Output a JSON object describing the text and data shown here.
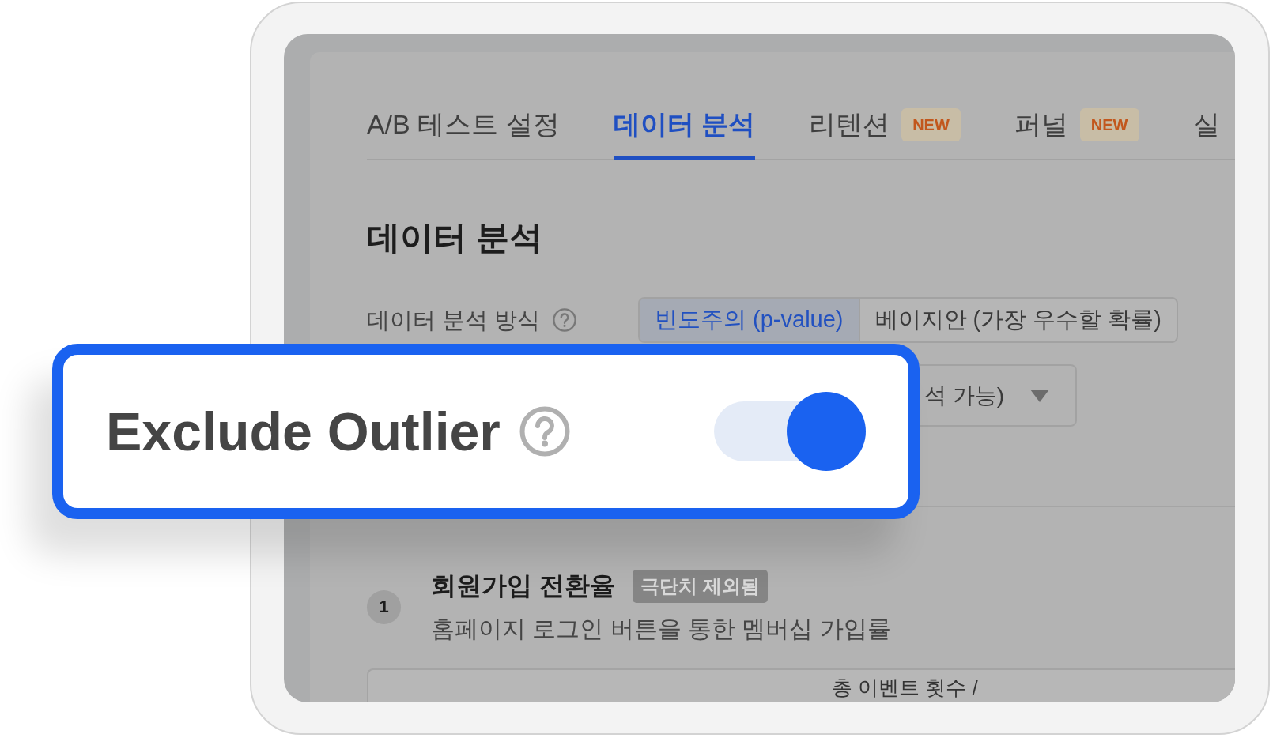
{
  "tabs": [
    {
      "label": "A/B 테스트 설정",
      "selected": false
    },
    {
      "label": "데이터 분석",
      "selected": true
    },
    {
      "label": "리텐션",
      "selected": false,
      "badge": "NEW"
    },
    {
      "label": "퍼널",
      "selected": false,
      "badge": "NEW"
    },
    {
      "label": "실",
      "selected": false
    }
  ],
  "page_title": "데이터 분석",
  "analysis_method": {
    "label": "데이터 분석 방식",
    "options": [
      {
        "label": "빈도주의 (p-value)",
        "selected": true
      },
      {
        "label": "베이지안 (가장 우수할 확률)",
        "selected": false
      }
    ]
  },
  "dropdown": {
    "value": "석 가능)"
  },
  "highlight_card": {
    "label": "Exclude Outlier",
    "toggle": {
      "on": true
    }
  },
  "metrics": [
    {
      "number": "1",
      "title": "회원가입 전환율",
      "badge": "극단치 제외됨",
      "description": "홈페이지 로그인 버튼을 통한 멤버십 가입률"
    }
  ],
  "table": {
    "columns": [
      "총 이벤트 횟수 /"
    ]
  }
}
